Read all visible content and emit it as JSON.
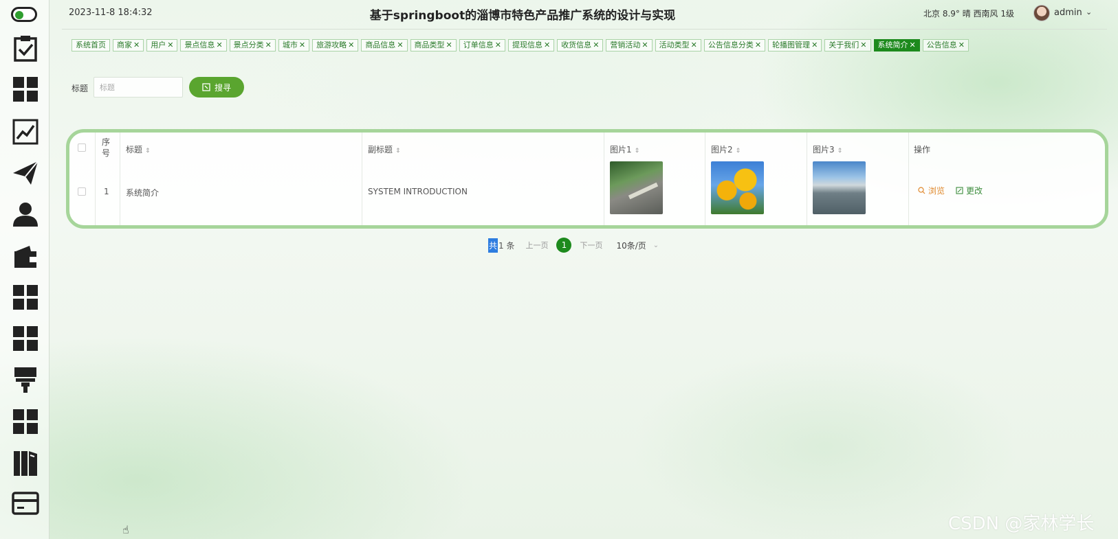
{
  "header": {
    "datetime": "2023-11-8 18:4:32",
    "title": "基于springboot的淄博市特色产品推广系统的设计与实现",
    "weather": "北京  8.9°  晴  西南风  1级",
    "username": "admin",
    "caret": "⌄"
  },
  "sidebar": {
    "toggle": "sidebar-toggle",
    "icons": [
      "clipboard-check-icon",
      "grid-icon",
      "chart-line-icon",
      "paper-plane-icon",
      "user-icon",
      "wallet-icon",
      "grid-icon",
      "grid-icon",
      "paint-roller-icon",
      "grid-icon",
      "books-icon",
      "card-icon"
    ]
  },
  "tags": [
    {
      "label": "系统首页",
      "closable": false
    },
    {
      "label": "商家",
      "closable": true
    },
    {
      "label": "用户",
      "closable": true
    },
    {
      "label": "景点信息",
      "closable": true
    },
    {
      "label": "景点分类",
      "closable": true
    },
    {
      "label": "城市",
      "closable": true
    },
    {
      "label": "旅游攻略",
      "closable": true
    },
    {
      "label": "商品信息",
      "closable": true
    },
    {
      "label": "商品类型",
      "closable": true
    },
    {
      "label": "订单信息",
      "closable": true
    },
    {
      "label": "提现信息",
      "closable": true
    },
    {
      "label": "收货信息",
      "closable": true
    },
    {
      "label": "营销活动",
      "closable": true
    },
    {
      "label": "活动类型",
      "closable": true
    },
    {
      "label": "公告信息分类",
      "closable": true
    },
    {
      "label": "轮播图管理",
      "closable": true
    },
    {
      "label": "关于我们",
      "closable": true
    },
    {
      "label": "系统简介",
      "closable": true,
      "active": true
    },
    {
      "label": "公告信息",
      "closable": true
    }
  ],
  "search": {
    "label": "标题",
    "placeholder": "标题",
    "button": "搜寻"
  },
  "table": {
    "columns": [
      "序号",
      "标题",
      "副标题",
      "图片1",
      "图片2",
      "图片3",
      "操作"
    ],
    "rows": [
      {
        "index": "1",
        "title": "系统简介",
        "subtitle": "SYSTEM INTRODUCTION"
      }
    ],
    "actions": {
      "view": "浏览",
      "edit": "更改"
    }
  },
  "pagination": {
    "total_prefix": "共",
    "total_rest": "1 条",
    "prev": "上一页",
    "current": "1",
    "next": "下一页",
    "page_size": "10条/页"
  },
  "watermark": "CSDN @家林学长",
  "colors": {
    "accent": "#1d8a1d",
    "button": "#5aa52f",
    "table_border": "#a6d59a",
    "view": "#e0892e"
  }
}
